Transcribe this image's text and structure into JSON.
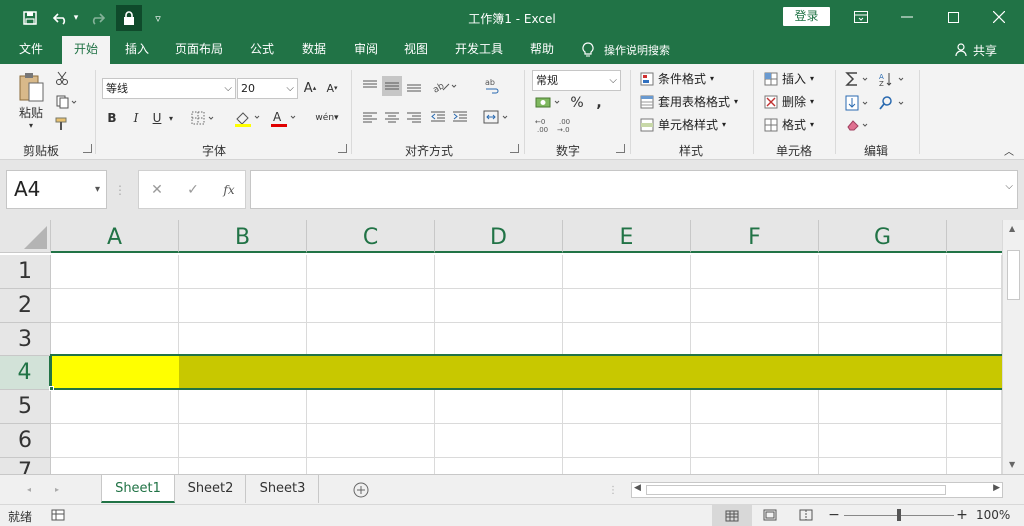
{
  "titlebar": {
    "title": "工作簿1 - Excel",
    "login_label": "登录"
  },
  "menu": {
    "tabs": [
      "文件",
      "开始",
      "插入",
      "页面布局",
      "公式",
      "数据",
      "审阅",
      "视图",
      "开发工具",
      "帮助"
    ],
    "active_tab": "开始",
    "tell_me": "操作说明搜索",
    "share": "共享"
  },
  "ribbon": {
    "clipboard": {
      "paste_label": "粘贴",
      "group_label": "剪贴板"
    },
    "font": {
      "font_name": "等线",
      "font_size": "20",
      "bold": "B",
      "italic": "I",
      "underline": "U",
      "group_label": "字体",
      "grow": "A",
      "shrink": "A",
      "wen": "wén"
    },
    "alignment": {
      "group_label": "对齐方式"
    },
    "number": {
      "format": "常规",
      "group_label": "数字",
      "percent": "%",
      "comma": ","
    },
    "styles": {
      "conditional": "条件格式",
      "table": "套用表格格式",
      "cell_styles": "单元格样式",
      "group_label": "样式"
    },
    "cells": {
      "insert": "插入",
      "delete": "删除",
      "format": "格式",
      "group_label": "单元格"
    },
    "editing": {
      "group_label": "编辑"
    }
  },
  "formula_bar": {
    "name_box": "A4",
    "fx_label": "fx",
    "formula": ""
  },
  "sheet": {
    "columns": [
      "A",
      "B",
      "C",
      "D",
      "E",
      "F",
      "G"
    ],
    "rows": [
      "1",
      "2",
      "3",
      "4",
      "5",
      "6",
      "7"
    ],
    "selected_row": "4",
    "selected_cell": "A4",
    "highlight_colors": {
      "a4": "#ffff00",
      "row4_rest": "#c8c800"
    }
  },
  "tabs": {
    "sheets": [
      "Sheet1",
      "Sheet2",
      "Sheet3"
    ],
    "active": "Sheet1"
  },
  "statusbar": {
    "ready": "就绪",
    "zoom": "100%"
  },
  "colors": {
    "accent": "#217346"
  }
}
